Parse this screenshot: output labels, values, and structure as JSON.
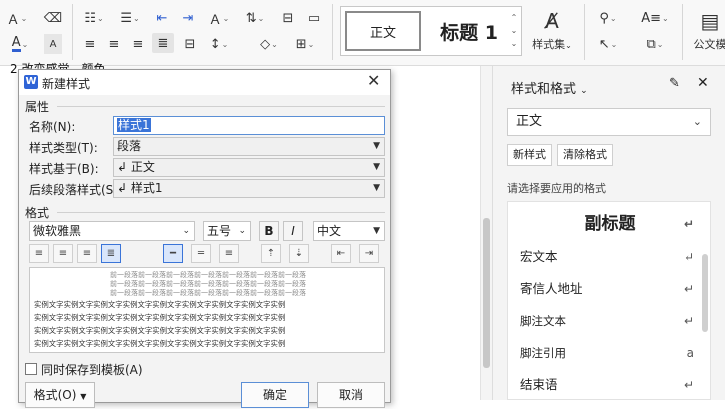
{
  "ribbon": {
    "row1": {
      "clear_format": "Ａ",
      "font_color": "A",
      "bullets": "☷",
      "numbering": "☰",
      "indent_dec": "⇤",
      "indent_inc": "⇥",
      "char_spacing": "Ａ",
      "sort": "⇅",
      "char_border": "⊟",
      "para_mark": "▭"
    },
    "row2": {
      "highlight_label": "A",
      "align_left": "≡",
      "align_center": "≡",
      "align_right": "≡",
      "justify": "≣",
      "distribute": "⊟",
      "line_spacing": "↕",
      "shading": "◇",
      "borders": "⊞"
    },
    "gallery": {
      "style1": "正文",
      "style2": "标题 1"
    },
    "styles_set": "样式集",
    "find_icon": "⚲",
    "select_icon": "↖",
    "textbox_icon": "A≡",
    "shape_icon": "⧉",
    "official": "公文模"
  },
  "document": {
    "fragment": "2  改变感觉，颜色"
  },
  "panel": {
    "title": "样式和格式",
    "current_style": "正文",
    "new_style_btn": "新样式",
    "clear_format_btn": "清除格式",
    "hint": "请选择要应用的格式",
    "items": [
      {
        "label": "副标题",
        "mark": "↵"
      },
      {
        "label": "宏文本",
        "mark": "↵"
      },
      {
        "label": "寄信人地址",
        "mark": "↵"
      },
      {
        "label": "脚注文本",
        "mark": "↵"
      },
      {
        "label": "脚注引用",
        "mark": "a"
      },
      {
        "label": "结束语",
        "mark": "↵"
      }
    ]
  },
  "dialog": {
    "logo": "W",
    "title": "新建样式",
    "section_props": "属性",
    "name_label": "名称(N):",
    "name_value": "样式1",
    "type_label": "样式类型(T):",
    "type_value": "段落",
    "based_label": "样式基于(B):",
    "based_value": "↲ 正文",
    "next_label": "后续段落样式(S):",
    "next_value": "↲ 样式1",
    "section_format": "格式",
    "font": "微软雅黑",
    "size": "五号",
    "bold": "B",
    "italic": "I",
    "lang": "中文",
    "preview_prev": "前一段落前一段落前一段落前一段落前一段落前一段落前一段落",
    "preview_example": "实例文字实例文字实例文字实例文字实例文字实例文字实例文字实例文字实例",
    "save_template": "同时保存到模板(A)",
    "format_btn": "格式(O)",
    "ok_btn": "确定",
    "cancel_btn": "取消"
  }
}
